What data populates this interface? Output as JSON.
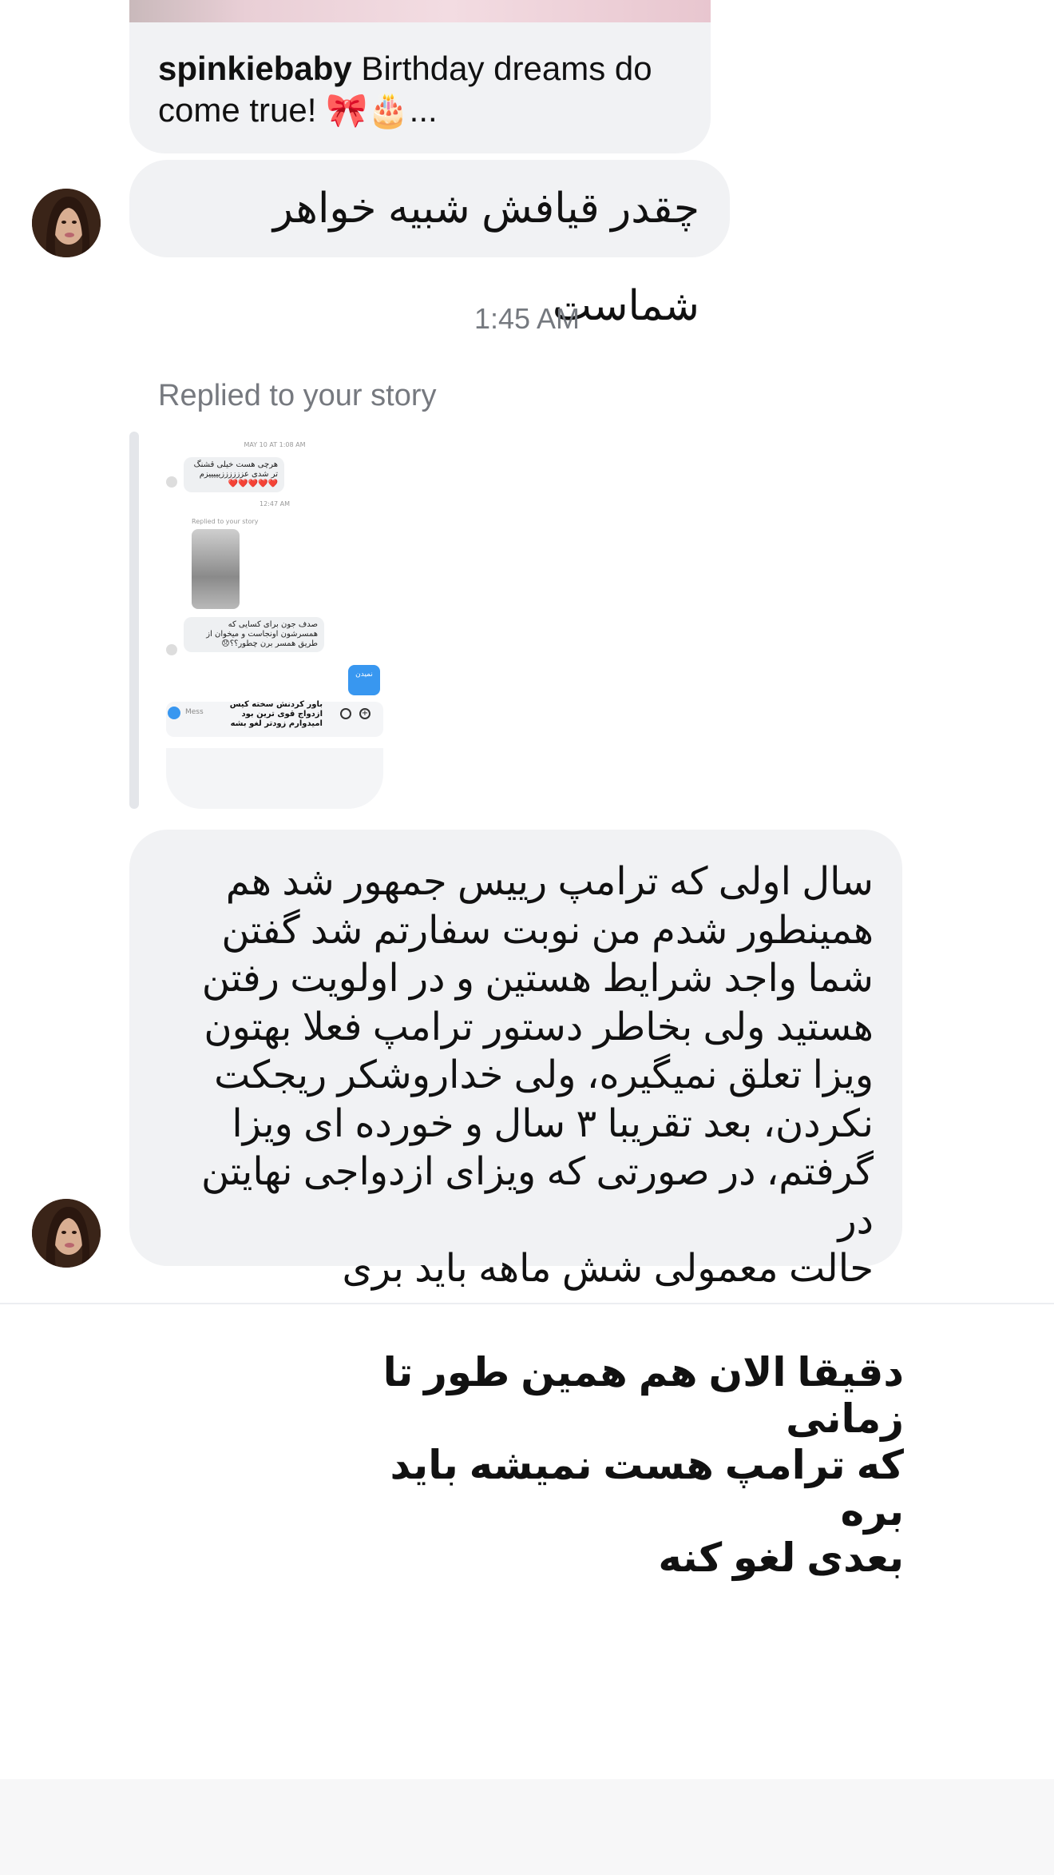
{
  "post": {
    "username": "spinkiebaby",
    "caption": " Birthday dreams do come true! 🎀🎂..."
  },
  "messages": {
    "first": "چقدر قیافش شبیه خواهر شماست",
    "timestamp": "1:45 AM",
    "replied_label": "Replied to your story",
    "second": "سال اولی که ترامپ رییس جمهور شد هم\nهمینطور شدم من نوبت سفارتم شد گفتن\nشما واجد شرایط هستین و در اولویت رفتن\nهستید ولی بخاطر دستور ترامپ فعلا بهتون\nویزا تعلق نمیگیره، ولی خداروشکر ریجکت\nنکردن، بعد تقریبا ۳ سال و خورده ای ویزا\nگرفتم، در صورتی که ویزای ازدواجی نهایتن در\nحالت معمولی شش ماهه باید بری"
  },
  "overlay_text": "دقیقا الان هم همین طور تا زمانی\nکه ترامپ هست نمیشه باید بره\nبعدی لغو کنه",
  "story_thumbnail": {
    "date_header": "MAY 10 AT 1:08 AM",
    "msg1": "هرچی هست خیلی قشنگ تر شدی عززززززیییییزم❤️❤️❤️❤️❤️",
    "time2": "12:47 AM",
    "replied": "Replied to your story",
    "msg2": "صدف جون برای کسایی که همسرشون اونجاست و میخوان از طریق همسر برن چطور؟؟😞",
    "blue_label": "نمیدن",
    "input_overlay": "باور کردنش سخته کیس ازدواج قوی ترین بود امیدوارم زودتر لغو بشه",
    "input_placeholder": "Mess"
  },
  "colors": {
    "bubble_bg": "#f1f2f4",
    "meta_text": "#76797f",
    "accent_blue": "#3897f0"
  },
  "icons": [
    "avatar",
    "camera-icon",
    "sticker-icon",
    "add-icon"
  ]
}
